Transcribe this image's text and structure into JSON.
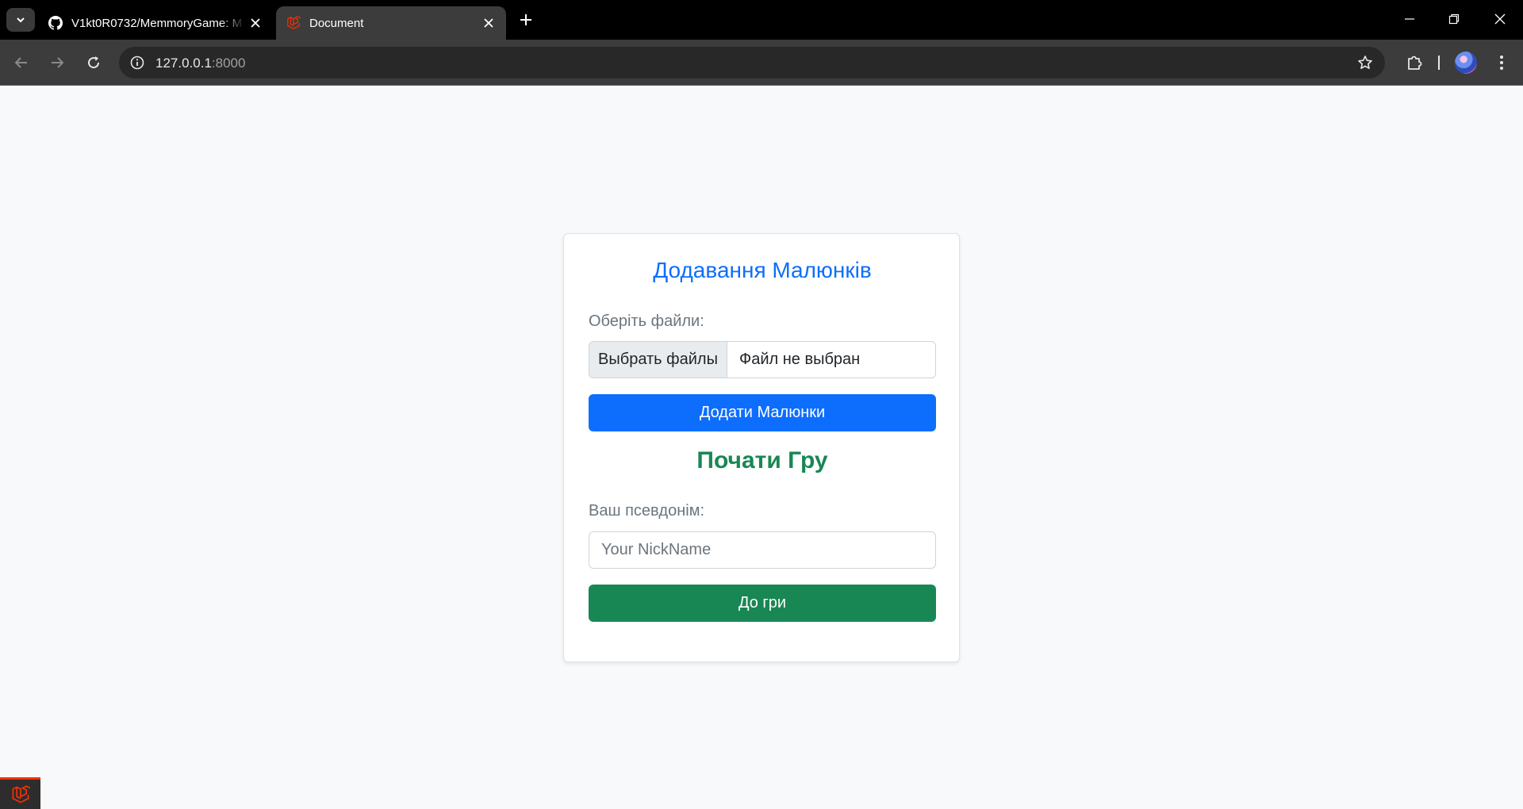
{
  "browser": {
    "tabs": [
      {
        "title": "V1kt0R0732/MemmoryGame: M",
        "favicon": "github-icon",
        "active": false
      },
      {
        "title": "Document",
        "favicon": "laravel-icon",
        "active": true
      }
    ],
    "url_host": "127.0.0.1",
    "url_port": ":8000"
  },
  "page": {
    "upload": {
      "heading": "Додавання Малюнків",
      "files_label": "Оберіть файли:",
      "choose_button": "Выбрать файлы",
      "no_file_text": "Файл не выбран",
      "submit_label": "Додати Малюнки"
    },
    "game": {
      "heading": "Почати Гру",
      "nickname_label": "Ваш псевдонім:",
      "nickname_placeholder": "Your NickName",
      "nickname_value": "",
      "submit_label": "До гри"
    }
  },
  "colors": {
    "primary": "#0d6efd",
    "success": "#198754",
    "page_background": "#f8f9fa",
    "browser_frame": "#3c3c3c"
  }
}
